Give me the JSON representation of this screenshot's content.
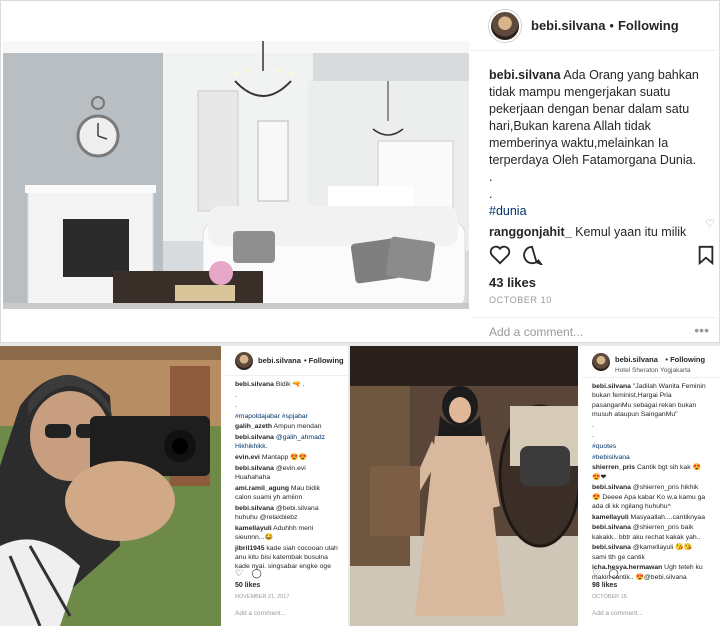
{
  "top_post": {
    "username": "bebi.silvana",
    "separator": "•",
    "follow_status": "Following",
    "caption_user": "bebi.silvana",
    "caption_text": "Ada Orang yang bahkan tidak mampu mengerjakan suatu pekerjaan dengan benar dalam satu hari,Bukan karena Allah tidak memberinya waktu,melainkan Ia terperdaya Oleh Fatamorgana Dunia.",
    "caption_dash1": ".",
    "caption_dash2": ".",
    "hashtag": "#dunia",
    "comment_user": "ranggonjahit_",
    "comment_text": "Kemul yaan itu milik alloh tapi alloh meni tipkan itu di hati manu siya salasatu nya mung kin ada dalam hati kamu sung guh beruntung",
    "likes": "43 likes",
    "date": "OCTOBER 10",
    "add_comment_placeholder": "Add a comment...",
    "more_glyph": "•••"
  },
  "bottom_left_post": {
    "username": "bebi.silvana",
    "follow_status": "• Following",
    "caption_user": "bebi.silvana",
    "caption_text": "Bidik 🔫 .",
    "lines": [
      ".",
      ".",
      "#mapoldajabar #spjabar"
    ],
    "comments": [
      {
        "user": "galih_azeth",
        "text": "Ampun mendan"
      },
      {
        "user": "bebi.silvana",
        "text": "@galih_ahmadz Hikhikhikk."
      },
      {
        "user": "evin.evi",
        "text": "Mantapp 😍😍"
      },
      {
        "user": "bebi.silvana",
        "text": "@evin.evi Huahahaha"
      },
      {
        "user": "ami.ramil_agung",
        "text": "Mau bidik calon suami yh amiinn"
      },
      {
        "user": "bebi.silvana",
        "text": "@bebi.silvana huhuhu @relaxbiebz"
      },
      {
        "user": "kamellayuli",
        "text": "Aduhhh meni sieunnn...😂"
      },
      {
        "user": "jibril1945",
        "text": "kade siah cocooan ulah anu kitu bisi katembak busulna kade nyai. singsabar engke oge ges waktuna ditembak jodo"
      }
    ],
    "likes": "50 likes",
    "date": "NOVEMBER 21, 2017",
    "add_comment_placeholder": "Add a comment..."
  },
  "bottom_right_post": {
    "username": "bebi.silvana",
    "follow_status": "• Following",
    "location": "Hotel Sheraton Yogjakarta",
    "caption_user": "bebi.silvana",
    "caption_text": "\"Jadilah Wanita Feminin bukan feminist,Hargai Pria pasanganMu sebagai rekan bukan musuh ataupun SainganMu\"",
    "lines": [
      ".",
      ".",
      "#quotes",
      "#bebisilvana"
    ],
    "comments": [
      {
        "user": "shierren_pris",
        "text": "Cantik bgt sih kak 😍😍❤"
      },
      {
        "user": "bebi.silvana",
        "text": "@shierren_pris hikhik😍 Deeee Apa kabar Ko w.a kamu ga ada di kk ngilang huhuhu^"
      },
      {
        "user": "kamellayuli",
        "text": "Masyaallah....cantiknyaa"
      },
      {
        "user": "bebi.silvana",
        "text": "@shierren_pris baik kakakk.. bbtr aku rechat kakak yah.."
      },
      {
        "user": "bebi.silvana",
        "text": "@kamellayuli 😘😘 sami tth ge cantik"
      },
      {
        "user": "icha.hesya.hermawan",
        "text": "Ugh teteh ku makin cantik.. 😍@bebi.silvana"
      }
    ],
    "likes": "98 likes",
    "date": "OCTOBER 15",
    "add_comment_placeholder": "Add a comment..."
  },
  "icons": [
    "heart-icon",
    "comment-icon",
    "bookmark-icon",
    "more-icon"
  ],
  "colors": {
    "hashtag": "#003569",
    "meta": "#999999",
    "border": "#dbdbdb"
  }
}
